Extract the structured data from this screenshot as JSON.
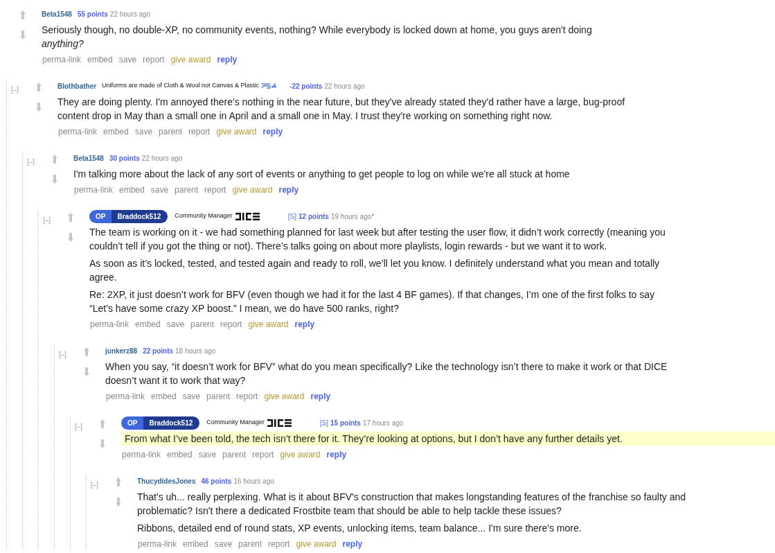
{
  "comments": [
    {
      "author": "Beta1548",
      "op": false,
      "points": "55 points",
      "time": "22 hours ago",
      "highlighted": false,
      "paragraphs": [
        "Seriously though, no double-XP, no community events, nothing? While everybody is locked down at home, you guys aren't doing *anything?*"
      ],
      "actions": [
        {
          "label": "perma-link",
          "kind": "link"
        },
        {
          "label": "embed",
          "kind": "link"
        },
        {
          "label": "save",
          "kind": "link"
        },
        {
          "label": "report",
          "kind": "link"
        },
        {
          "label": "give award",
          "kind": "award"
        },
        {
          "label": "reply",
          "kind": "reply"
        }
      ],
      "children": [
        {
          "toggle": "[–]",
          "author": "Blothbather",
          "op": false,
          "flair": "Uniforms are made of Cloth & Wool not Canvas & Plastic",
          "flair_icon": {
            "kind": "console"
          },
          "points": "-22 points",
          "time": "22 hours ago",
          "highlighted": false,
          "paragraphs": [
            "They are doing plenty. I'm annoyed there's nothing in the near future, but they've already stated they'd rather have a large, bug-proof content drop in May than a small one in April and a small one in May. I trust they're working on something right now."
          ],
          "actions": [
            {
              "label": "perma-link",
              "kind": "link"
            },
            {
              "label": "embed",
              "kind": "link"
            },
            {
              "label": "save",
              "kind": "link"
            },
            {
              "label": "parent",
              "kind": "link"
            },
            {
              "label": "report",
              "kind": "link"
            },
            {
              "label": "give award",
              "kind": "award"
            },
            {
              "label": "reply",
              "kind": "reply"
            }
          ],
          "children": [
            {
              "toggle": "[–]",
              "author": "Beta1548",
              "op": false,
              "points": "30 points",
              "time": "22 hours ago",
              "highlighted": false,
              "paragraphs": [
                "I'm talking more about the lack of any sort of events or anything to get people to log on while we're all stuck at home"
              ],
              "actions": [
                {
                  "label": "perma-link",
                  "kind": "link"
                },
                {
                  "label": "embed",
                  "kind": "link"
                },
                {
                  "label": "save",
                  "kind": "link"
                },
                {
                  "label": "parent",
                  "kind": "link"
                },
                {
                  "label": "report",
                  "kind": "link"
                },
                {
                  "label": "give award",
                  "kind": "award"
                },
                {
                  "label": "reply",
                  "kind": "reply"
                }
              ],
              "children": [
                {
                  "toggle": "[–]",
                  "op_label": "OP",
                  "author": "Braddock512",
                  "op": true,
                  "flair": "Community Manager",
                  "flair_icon": {
                    "kind": "studio"
                  },
                  "tag": "[S]",
                  "points": "12 points",
                  "time": "19 hours ago*",
                  "highlighted": false,
                  "paragraphs": [
                    "The team is working on it - we had something planned for last week but after testing the user flow, it didn’t work correctly (meaning you couldn’t tell if you got the thing or not). There’s talks going on about more playlists, login rewards - but we want it to work.",
                    "As soon as it’s locked, tested, and tested again and ready to roll, we’ll let you know. I definitely understand what you mean and totally agree.",
                    "Re: 2XP, it just doesn’t work for BFV (even though we had it for the last 4 BF games). If that changes, I’m one of the first folks to say “Let’s have some crazy XP boost.” I mean, we do have 500 ranks, right?"
                  ],
                  "actions": [
                    {
                      "label": "perma-link",
                      "kind": "link"
                    },
                    {
                      "label": "embed",
                      "kind": "link"
                    },
                    {
                      "label": "save",
                      "kind": "link"
                    },
                    {
                      "label": "parent",
                      "kind": "link"
                    },
                    {
                      "label": "report",
                      "kind": "link"
                    },
                    {
                      "label": "give award",
                      "kind": "award"
                    },
                    {
                      "label": "reply",
                      "kind": "reply"
                    }
                  ],
                  "children": [
                    {
                      "toggle": "[–]",
                      "author": "junkerz88",
                      "op": false,
                      "points": "22 points",
                      "time": "18 hours ago",
                      "highlighted": false,
                      "paragraphs": [
                        "When you say, “it doesn’t work for BFV” what do you mean specifically? Like the technology isn’t there to make it work or that DICE doesn’t want it to work that way?"
                      ],
                      "actions": [
                        {
                          "label": "perma-link",
                          "kind": "link"
                        },
                        {
                          "label": "embed",
                          "kind": "link"
                        },
                        {
                          "label": "save",
                          "kind": "link"
                        },
                        {
                          "label": "parent",
                          "kind": "link"
                        },
                        {
                          "label": "report",
                          "kind": "link"
                        },
                        {
                          "label": "give award",
                          "kind": "award"
                        },
                        {
                          "label": "reply",
                          "kind": "reply"
                        }
                      ],
                      "children": [
                        {
                          "toggle": "[–]",
                          "op_label": "OP",
                          "author": "Braddock512",
                          "op": true,
                          "flair": "Community Manager",
                          "flair_icon": {
                            "kind": "studio"
                          },
                          "tag": "[S]",
                          "points": "15 points",
                          "time": "17 hours ago",
                          "highlighted": true,
                          "paragraphs": [
                            "From what I’ve been told, the tech isn’t there for it. They’re looking at options, but I don’t have any further details yet."
                          ],
                          "actions": [
                            {
                              "label": "perma-link",
                              "kind": "link"
                            },
                            {
                              "label": "embed",
                              "kind": "link"
                            },
                            {
                              "label": "save",
                              "kind": "link"
                            },
                            {
                              "label": "parent",
                              "kind": "link"
                            },
                            {
                              "label": "report",
                              "kind": "link"
                            },
                            {
                              "label": "give award",
                              "kind": "award"
                            },
                            {
                              "label": "reply",
                              "kind": "reply"
                            }
                          ],
                          "children": [
                            {
                              "toggle": "[–]",
                              "author": "ThucydidesJones",
                              "op": false,
                              "points": "46 points",
                              "time": "16 hours ago",
                              "highlighted": false,
                              "paragraphs": [
                                "That's uh... really perplexing. What is it about BFV's construction that makes longstanding features of the franchise so faulty and problematic? Isn't there a dedicated Frostbite team that should be able to help tackle these issues?",
                                "Ribbons, detailed end of round stats, XP events, unlocking items, team balance... I'm sure there's more."
                              ],
                              "actions": [
                                {
                                  "label": "perma-link",
                                  "kind": "link"
                                },
                                {
                                  "label": "embed",
                                  "kind": "link"
                                },
                                {
                                  "label": "save",
                                  "kind": "link"
                                },
                                {
                                  "label": "parent",
                                  "kind": "link"
                                },
                                {
                                  "label": "report",
                                  "kind": "link"
                                },
                                {
                                  "label": "give award",
                                  "kind": "award"
                                },
                                {
                                  "label": "reply",
                                  "kind": "reply"
                                }
                              ]
                            }
                          ]
                        }
                      ]
                    }
                  ]
                }
              ]
            }
          ]
        }
      ]
    }
  ]
}
